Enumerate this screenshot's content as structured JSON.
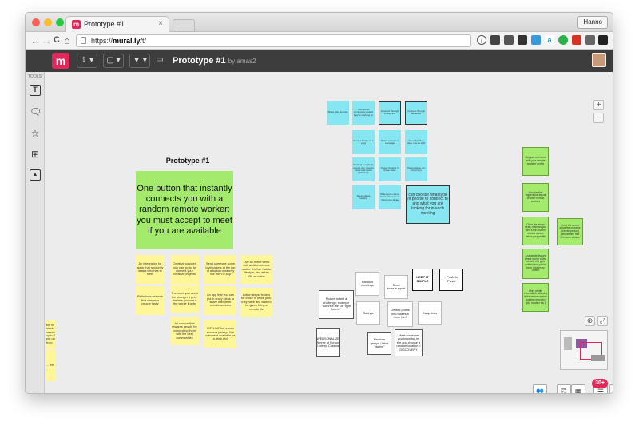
{
  "browser": {
    "tab_title": "Prototype #1",
    "tab_icon": "m",
    "tab_close": "×",
    "profile": "Hanno",
    "url_prefix": "https://",
    "url_host": "mural.ly",
    "url_path": "/t/",
    "nav_icons": {
      "back": "←",
      "forward": "→",
      "reload": "C",
      "home": "⌂"
    }
  },
  "app": {
    "logo": "m",
    "share_label": "⇪ ▾",
    "frame_label": "▢ ▾",
    "filter_label": "▼ ▾",
    "present_label": "▭",
    "title": "Prototype #1",
    "byline": "by amas2"
  },
  "toolbar": {
    "label": "TOOLS"
  },
  "board": {
    "heading": "Prototype #1",
    "main_note": "One button that instantly connects you with a random remote worker: you must accept to meet if you are available",
    "yellow_notes": [
      "An integration for slack that randomly draws who has to meet",
      "Creative counsel: you can go to, to connect your creative projects",
      "Send someone some lovebuckets at the top of a button randomly like the YO app",
      "Live an entire week with another remote worker (his/her habits, lifestyle, etc) either IRL or online",
      "Reltallows network that connects people fastly",
      "The more you use it the stronger it gets: the less you use it the worse it gets",
      "An app that you can put in crazy ideas to share with other remote workers",
      "Action steps: fosters for those in office jobs: they have and want to be given living a remote life",
      "An service that rewards people for connecting them with the best communities",
      "HOTLINE for remote workers (always first comment available for a drink etc)",
      "ble in slack randomly, up to 3 per day, from",
      "... the"
    ],
    "cyan_notes": [
      "Share their journey",
      "Connect to community project they're working on",
      "Connect through Instagram",
      "Connect through Behance",
      "Send a badge as a ping",
      "Share a tip (as a message",
      "See what they have met so with",
      "Working in a plenty remote city: receive news and social gatherings",
      "Group projects in those cities",
      "Travel advice (ex: Currency)",
      "Speed dates rotating",
      "Share your colony and let them know about new ideas",
      "can choose what type of people to connect to and what you are looking for in each meeting"
    ],
    "green_notes": [
      "Stripped-out home with your remote workers' profile",
      "A button that triggers the arrival of other remote workers",
      "Once the wheel deals, it shows you who's the chosen remote worker below your profile",
      "Once the wheel stops the outcome (chosen person) gets notified that he's been chosen",
      "A separate feature where you're called on one of it gets notified and you've been chosen by others",
      "More profile information tells why is the remote worker working remotely (job, location etc.)"
    ],
    "white_notes": [
      "Random meetings",
      "Send loves/support",
      "Picture to test a challenge: example \"surprise me\" or \"type for me\"",
      "Ratings",
      "Limited profile info makes it more fun?",
      "Swap lives",
      "INPERSONALIZED Winner of Fortune Lottery, Casinos",
      "Random groups / blind \"dating\"",
      "Meet someone you know but let the app choose a random location = DISCOVERY"
    ],
    "bold_notes": [
      "KEEP IT SIMPLE",
      "+ Push for Pizza"
    ]
  },
  "controls": {
    "zoom_in": "+",
    "zoom_out": "−",
    "counter": "30+",
    "notif": "1"
  },
  "colors": {
    "accent": "#e2285a",
    "sticky_yellow": "#fff69a",
    "sticky_cyan": "#86e7f2",
    "sticky_green": "#a4ea6c",
    "header": "#3d3d3d"
  }
}
